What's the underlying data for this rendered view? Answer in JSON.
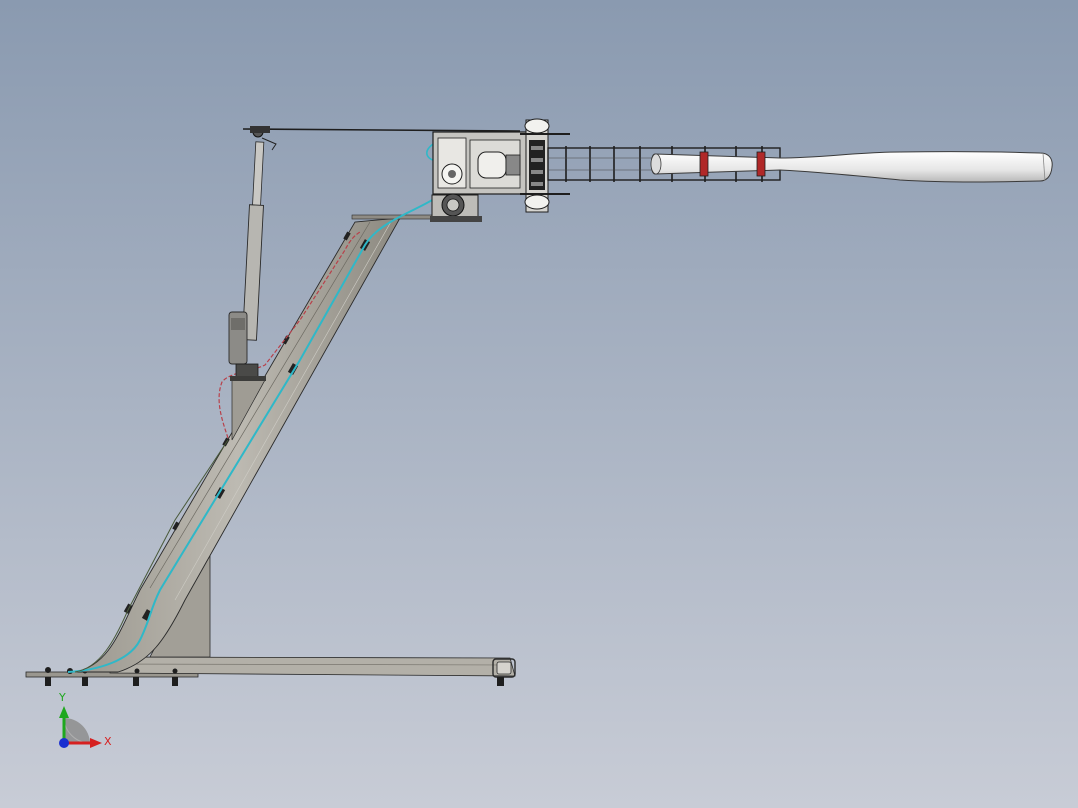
{
  "viewport": {
    "background_top": "#8a9ab0",
    "background_bottom": "#c8ccd6"
  },
  "triad": {
    "x_label": "X",
    "y_label": "Y",
    "x_color": "#d62020",
    "y_color": "#1fa81f",
    "z_color": "#1a2fd0"
  },
  "colors": {
    "frame_fill": "#a8a59d",
    "frame_dark": "#7d7a72",
    "edge": "#2a2a2a",
    "cyan_cable": "#2fb8c8",
    "red_cable": "#b8404a",
    "bat_fill": "#f2f2f2",
    "bat_band": "#b02828"
  }
}
